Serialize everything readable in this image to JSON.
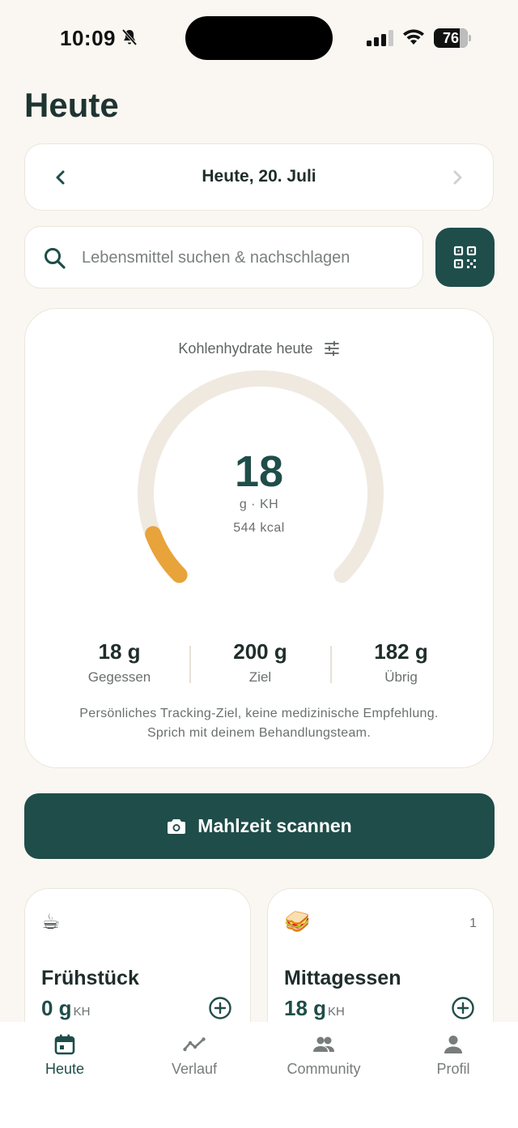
{
  "status_bar": {
    "time": "10:09",
    "battery": "76"
  },
  "page": {
    "title": "Heute"
  },
  "date_nav": {
    "label": "Heute, 20. Juli"
  },
  "search": {
    "placeholder": "Lebensmittel suchen & nachschlagen"
  },
  "carb_card": {
    "label": "Kohlenhydrate heute",
    "value": "18",
    "unit": "g · KH",
    "kcal": "544 kcal",
    "progress_fraction": 0.09,
    "stats": [
      {
        "value": "18 g",
        "label": "Gegessen"
      },
      {
        "value": "200 g",
        "label": "Ziel"
      },
      {
        "value": "182 g",
        "label": "Übrig"
      }
    ],
    "disclaimer_line1": "Persönliches Tracking-Ziel, keine medizinische Empfehlung.",
    "disclaimer_line2": "Sprich mit deinem Behandlungsteam."
  },
  "scan_button": {
    "label": "Mahlzeit scannen"
  },
  "meals": [
    {
      "emoji": "☕",
      "name": "Frühstück",
      "amount": "0 g",
      "unit": "KH",
      "count": ""
    },
    {
      "emoji": "🥪",
      "name": "Mittagessen",
      "amount": "18 g",
      "unit": "KH",
      "count": "1"
    }
  ],
  "tabs": [
    {
      "label": "Heute",
      "icon": "calendar-icon",
      "active": true
    },
    {
      "label": "Verlauf",
      "icon": "trend-icon",
      "active": false
    },
    {
      "label": "Community",
      "icon": "people-icon",
      "active": false
    },
    {
      "label": "Profil",
      "icon": "person-icon",
      "active": false
    }
  ],
  "colors": {
    "background": "#faf7f2",
    "primary": "#1f4d49",
    "gauge_track": "#efe9e0",
    "gauge_fill": "#e8a33a"
  }
}
